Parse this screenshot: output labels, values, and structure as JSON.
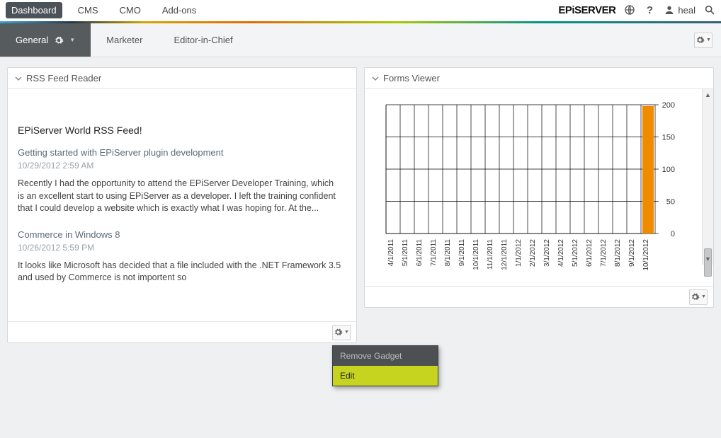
{
  "topnav": {
    "items": [
      "Dashboard",
      "CMS",
      "CMO",
      "Add-ons"
    ],
    "active_index": 0,
    "logo": "EPiSERVER",
    "user": "heal"
  },
  "subtabs": {
    "items": [
      "General",
      "Marketer",
      "Editor-in-Chief"
    ],
    "active_index": 0
  },
  "rss_gadget": {
    "title": "RSS Feed Reader",
    "feed_title": "EPiServer World RSS Feed!",
    "items": [
      {
        "title": "Getting started with EPiServer plugin development",
        "date": "10/29/2012 2:59 AM",
        "body": "Recently I had the opportunity to attend the EPiServer Developer Training, which is an excellent start to using EPiServer as a developer.  I left the training confident that I could develop a website which is exactly what I was hoping for.  At the..."
      },
      {
        "title": "Commerce in Windows 8",
        "date": "10/26/2012 5:59 PM",
        "body": "It looks like Microsoft has decided that a file included with the .NET Framework 3.5 and used by Commerce is not importent so"
      }
    ]
  },
  "forms_gadget": {
    "title": "Forms Viewer"
  },
  "context_menu": {
    "items": [
      {
        "label": "Remove Gadget",
        "hover": false
      },
      {
        "label": "Edit",
        "hover": true
      }
    ]
  },
  "chart_data": {
    "type": "bar",
    "categories": [
      "4/1/2011",
      "5/1/2011",
      "6/1/2011",
      "7/1/2011",
      "8/1/2011",
      "9/1/2011",
      "10/1/2011",
      "11/1/2011",
      "12/1/2011",
      "1/1/2012",
      "2/1/2012",
      "3/1/2012",
      "4/1/2012",
      "5/1/2012",
      "6/1/2012",
      "7/1/2012",
      "8/1/2012",
      "9/1/2012",
      "10/1/2012"
    ],
    "values": [
      0,
      0,
      0,
      0,
      0,
      0,
      0,
      0,
      0,
      0,
      0,
      0,
      0,
      0,
      0,
      0,
      0,
      0,
      198
    ],
    "ylim": [
      0,
      200
    ],
    "yticks": [
      0,
      50,
      100,
      150,
      200
    ],
    "title": "",
    "xlabel": "",
    "ylabel": ""
  }
}
